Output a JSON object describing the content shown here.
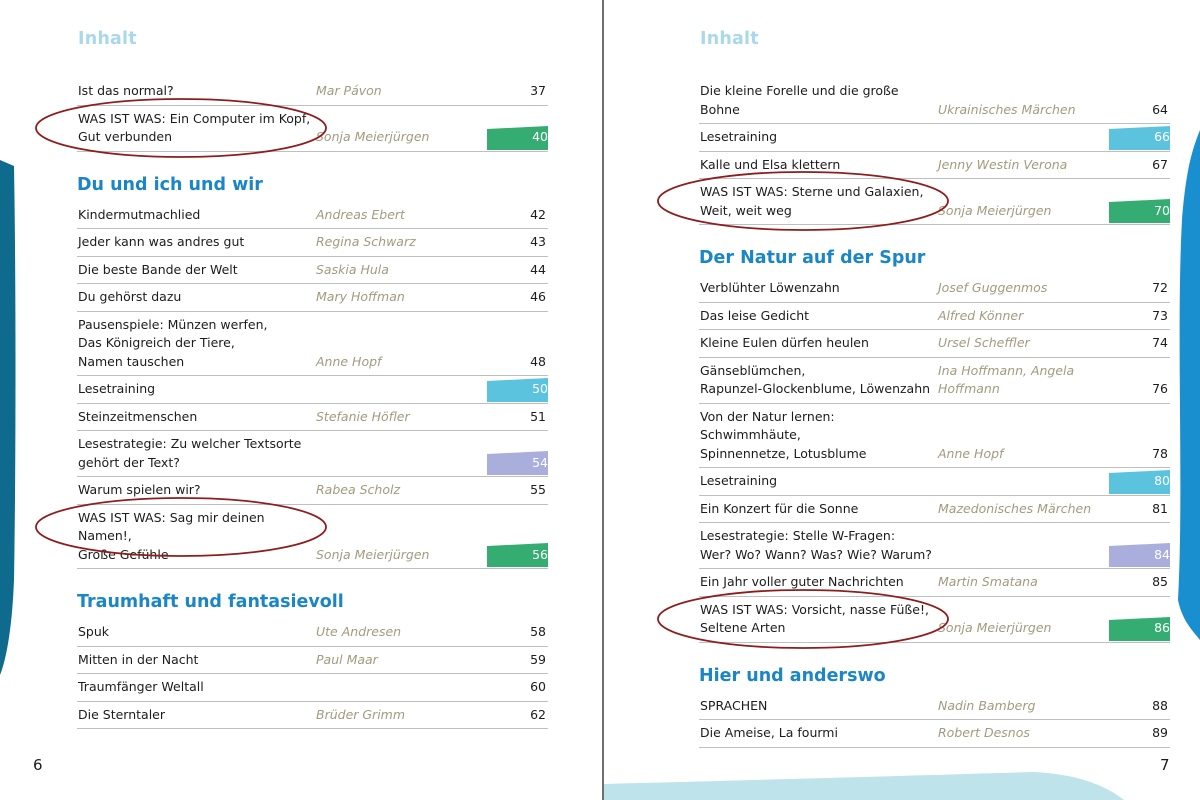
{
  "left_page": {
    "heading": "Inhalt",
    "page_number": "6",
    "sections": [
      {
        "title": "",
        "rows": [
          {
            "title": "Ist das normal?",
            "author": "Mar Pávon",
            "page": "37",
            "flag": null,
            "circled": false
          },
          {
            "title": "WAS IST WAS: Ein Computer im Kopf,\nGut verbunden",
            "author": "Sonja Meierjürgen",
            "page": "40",
            "flag": "green",
            "circled": true
          }
        ]
      },
      {
        "title": "Du und ich und wir",
        "rows": [
          {
            "title": "Kindermutmachlied",
            "author": "Andreas Ebert",
            "page": "42",
            "flag": null,
            "circled": false
          },
          {
            "title": "Jeder kann was andres gut",
            "author": "Regina Schwarz",
            "page": "43",
            "flag": null,
            "circled": false
          },
          {
            "title": "Die beste Bande der Welt",
            "author": "Saskia Hula",
            "page": "44",
            "flag": null,
            "circled": false
          },
          {
            "title": "Du gehörst dazu",
            "author": "Mary Hoffman",
            "page": "46",
            "flag": null,
            "circled": false
          },
          {
            "title": "Pausenspiele: Münzen werfen,\nDas Königreich der Tiere,\nNamen tauschen",
            "author": "Anne Hopf",
            "page": "48",
            "flag": null,
            "circled": false
          },
          {
            "title": "Lesetraining",
            "author": "",
            "page": "50",
            "flag": "blue",
            "circled": false
          },
          {
            "title": "Steinzeitmenschen",
            "author": "Stefanie Höfler",
            "page": "51",
            "flag": null,
            "circled": false
          },
          {
            "title": "Lesestrategie: Zu welcher Textsorte\ngehört der Text?",
            "author": "",
            "page": "54",
            "flag": "lavender",
            "circled": false
          },
          {
            "title": "Warum spielen wir?",
            "author": "Rabea Scholz",
            "page": "55",
            "flag": null,
            "circled": false
          },
          {
            "title": "WAS IST WAS: Sag mir deinen Namen!,\nGroße Gefühle",
            "author": "Sonja Meierjürgen",
            "page": "56",
            "flag": "green",
            "circled": true
          }
        ]
      },
      {
        "title": "Traumhaft und fantasievoll",
        "rows": [
          {
            "title": "Spuk",
            "author": "Ute Andresen",
            "page": "58",
            "flag": null,
            "circled": false
          },
          {
            "title": "Mitten in der Nacht",
            "author": "Paul Maar",
            "page": "59",
            "flag": null,
            "circled": false
          },
          {
            "title": "Traumfänger Weltall",
            "author": "",
            "page": "60",
            "flag": null,
            "circled": false
          },
          {
            "title": "Die Sterntaler",
            "author": "Brüder Grimm",
            "page": "62",
            "flag": null,
            "circled": false
          }
        ]
      }
    ]
  },
  "right_page": {
    "heading": "Inhalt",
    "page_number": "7",
    "sections": [
      {
        "title": "",
        "rows": [
          {
            "title": "Die kleine Forelle und die große Bohne",
            "author": "Ukrainisches Märchen",
            "page": "64",
            "flag": null,
            "circled": false
          },
          {
            "title": "Lesetraining",
            "author": "",
            "page": "66",
            "flag": "blue",
            "circled": false
          },
          {
            "title": "Kalle und Elsa klettern",
            "author": "Jenny Westin Verona",
            "page": "67",
            "flag": null,
            "circled": false
          },
          {
            "title": "WAS IST WAS: Sterne und Galaxien,\nWeit, weit weg",
            "author": "Sonja Meierjürgen",
            "page": "70",
            "flag": "green",
            "circled": true
          }
        ]
      },
      {
        "title": "Der Natur auf der Spur",
        "rows": [
          {
            "title": "Verblühter Löwenzahn",
            "author": "Josef Guggenmos",
            "page": "72",
            "flag": null,
            "circled": false
          },
          {
            "title": "Das leise Gedicht",
            "author": "Alfred Könner",
            "page": "73",
            "flag": null,
            "circled": false
          },
          {
            "title": "Kleine Eulen dürfen heulen",
            "author": "Ursel Scheffler",
            "page": "74",
            "flag": null,
            "circled": false
          },
          {
            "title": "Gänseblümchen,\nRapunzel-Glockenblume, Löwenzahn",
            "author": "Ina Hoffmann, Angela Hoffmann",
            "page": "76",
            "flag": null,
            "circled": false
          },
          {
            "title": "Von der Natur lernen: Schwimmhäute,\nSpinnennetze, Lotusblume",
            "author": "Anne Hopf",
            "page": "78",
            "flag": null,
            "circled": false
          },
          {
            "title": "Lesetraining",
            "author": "",
            "page": "80",
            "flag": "blue",
            "circled": false
          },
          {
            "title": "Ein Konzert für die Sonne",
            "author": "Mazedonisches Märchen",
            "page": "81",
            "flag": null,
            "circled": false
          },
          {
            "title": "Lesestrategie: Stelle W-Fragen:\nWer? Wo? Wann? Was? Wie? Warum?",
            "author": "",
            "page": "84",
            "flag": "lavender",
            "circled": false
          },
          {
            "title": "Ein Jahr voller guter Nachrichten",
            "author": "Martin Smatana",
            "page": "85",
            "flag": null,
            "circled": false
          },
          {
            "title": "WAS IST WAS: Vorsicht, nasse Füße!,\nSeltene Arten",
            "author": "Sonja Meierjürgen",
            "page": "86",
            "flag": "green",
            "circled": true
          }
        ]
      },
      {
        "title": "Hier und anderswo",
        "rows": [
          {
            "title": "SPRACHEN",
            "author": "Nadin Bamberg",
            "page": "88",
            "flag": null,
            "circled": false
          },
          {
            "title": "Die Ameise, La fourmi",
            "author": "Robert Desnos",
            "page": "89",
            "flag": null,
            "circled": false
          }
        ]
      }
    ]
  },
  "colors": {
    "section_title": "#1a86c6",
    "heading": "#a9d8ea",
    "author": "#a39a7e",
    "flag_green": "#35ad72",
    "flag_blue": "#5bc3dd",
    "flag_lavender": "#a9aedc",
    "annotation_ellipse": "#8e1d1d",
    "deco_dark_blue": "#0f6b8e",
    "deco_light_blue": "#bfe3ea"
  }
}
